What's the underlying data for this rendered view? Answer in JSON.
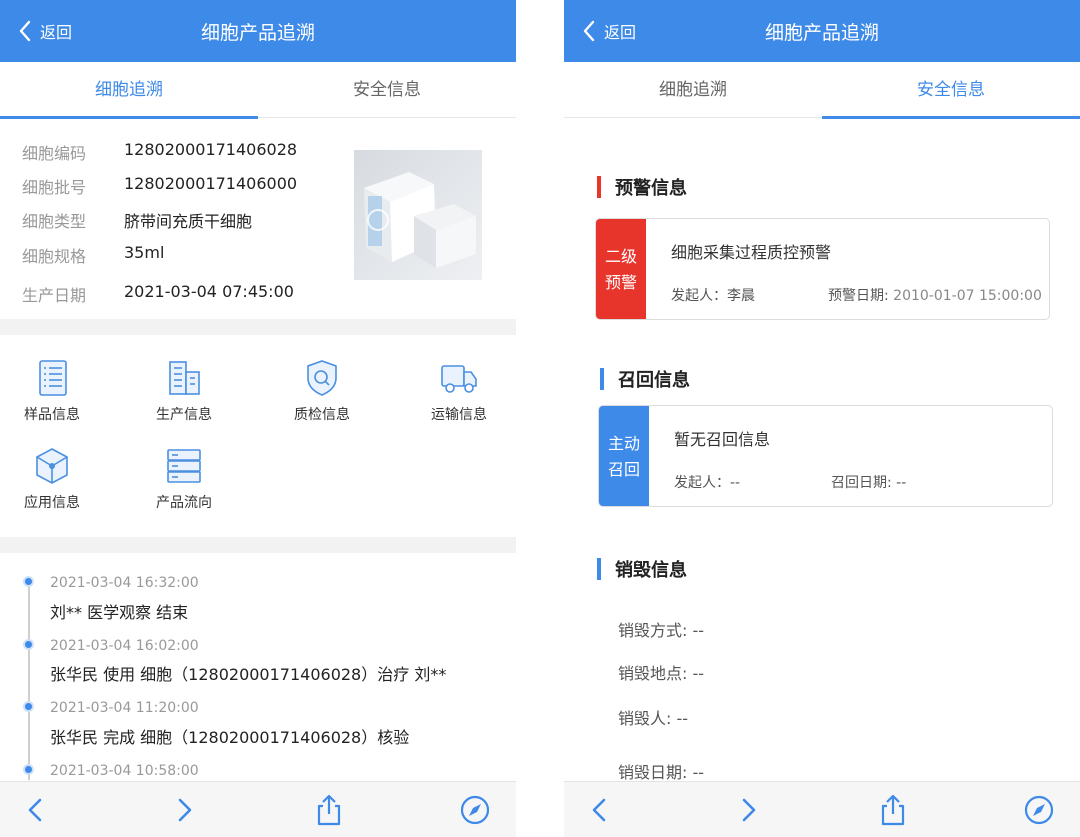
{
  "left": {
    "back_label": "返回",
    "title": "细胞产品追溯",
    "tabs": [
      "细胞追溯",
      "安全信息"
    ],
    "info": [
      {
        "label": "细胞编码",
        "value": "12802000171406028"
      },
      {
        "label": "细胞批号",
        "value": "12802000171406000"
      },
      {
        "label": "细胞类型",
        "value": "脐带间充质干细胞"
      },
      {
        "label": "细胞规格",
        "value": "35ml"
      },
      {
        "label": "生产日期",
        "value": "2021-03-04 07:45:00"
      }
    ],
    "grid": [
      {
        "label": "样品信息",
        "icon": "sample-list-icon"
      },
      {
        "label": "生产信息",
        "icon": "production-building-icon"
      },
      {
        "label": "质检信息",
        "icon": "quality-shield-icon"
      },
      {
        "label": "运输信息",
        "icon": "transport-truck-icon"
      },
      {
        "label": "应用信息",
        "icon": "application-cube-icon"
      },
      {
        "label": "产品流向",
        "icon": "product-flow-icon"
      }
    ],
    "timeline": [
      {
        "time": "2021-03-04 16:32:00",
        "text": "刘** 医学观察 结束"
      },
      {
        "time": "2021-03-04 16:02:00",
        "text": "张华民 使用 细胞（12802000171406028）治疗 刘**"
      },
      {
        "time": "2021-03-04 11:20:00",
        "text": "张华民 完成 细胞（12802000171406028）核验"
      },
      {
        "time": "2021-03-04 10:58:00",
        "text": ""
      }
    ]
  },
  "right": {
    "back_label": "返回",
    "title": "细胞产品追溯",
    "tabs": [
      "细胞追溯",
      "安全信息"
    ],
    "warning": {
      "section_title": "预警信息",
      "badge": "二级预警",
      "title": "细胞采集过程质控预警",
      "initiator_label": "发起人：",
      "initiator": "李晨",
      "date_label": "预警日期: ",
      "date": "2010-01-07 15:00:00"
    },
    "recall": {
      "section_title": "召回信息",
      "badge": "主动召回",
      "title": "暂无召回信息",
      "initiator_label": "发起人：",
      "initiator": "--",
      "date_label": "召回日期: ",
      "date": "--"
    },
    "destroy": {
      "section_title": "销毁信息",
      "rows": [
        {
          "label": "销毁方式: ",
          "value": "--"
        },
        {
          "label": "销毁地点: ",
          "value": "--"
        },
        {
          "label": "销毁人: ",
          "value": "--"
        },
        {
          "label": "销毁日期: ",
          "value": "--"
        }
      ]
    }
  },
  "colors": {
    "accent": "#3d8ae8",
    "warning_red": "#e8352c",
    "recall_blue": "#3d8ae8"
  }
}
